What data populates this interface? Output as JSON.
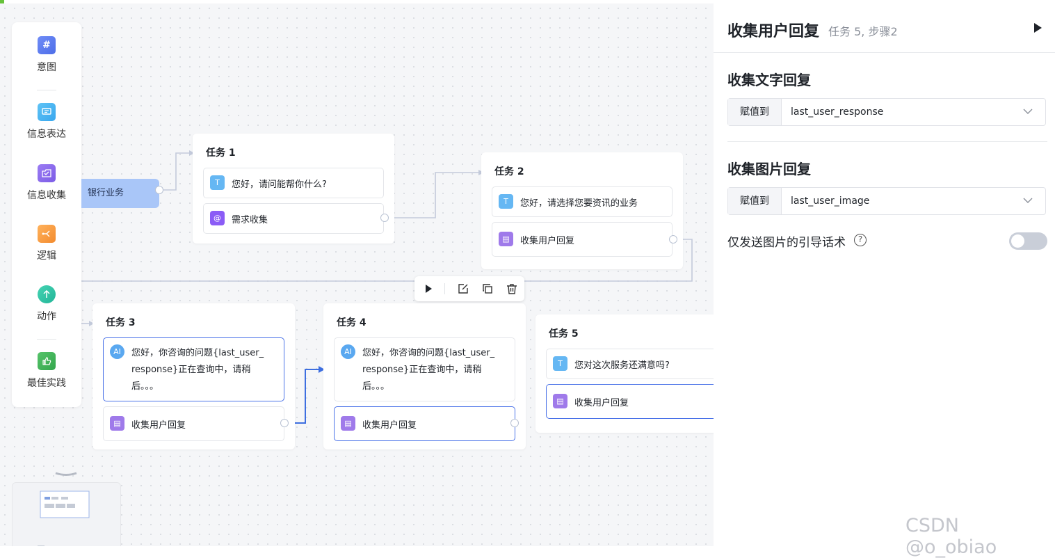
{
  "palette": {
    "items": [
      {
        "label": "意图",
        "icon": "hash-icon"
      },
      {
        "label": "信息表达",
        "icon": "message-icon"
      },
      {
        "label": "信息收集",
        "icon": "collect-icon"
      },
      {
        "label": "逻辑",
        "icon": "branch-icon"
      },
      {
        "label": "动作",
        "icon": "action-icon"
      },
      {
        "label": "最佳实践",
        "icon": "thumbs-up-icon"
      }
    ]
  },
  "canvas": {
    "entry_node": "银行业务",
    "nodes": [
      {
        "title": "任务 1",
        "steps": [
          {
            "text": "您好，请问能帮你什么?",
            "icon": "T"
          },
          {
            "text": "需求收集",
            "icon": "@"
          }
        ]
      },
      {
        "title": "任务 2",
        "steps": [
          {
            "text": "您好，请选择您要资讯的业务",
            "icon": "T"
          },
          {
            "text": "收集用户回复",
            "icon": "collect"
          }
        ]
      },
      {
        "title": "任务 3",
        "steps": [
          {
            "text": "您好，你咨询的问题{last_user_ response}正在查询中，请稍 后。。。",
            "line1": "您好，你咨询的问题{last_user_",
            "line2": "response}正在查询中，请稍",
            "line3": "后。。。",
            "icon": "AI"
          },
          {
            "text": "收集用户回复",
            "icon": "collect"
          }
        ]
      },
      {
        "title": "任务 4",
        "steps": [
          {
            "text": "您好，你咨询的问题{last_user_ response}正在查询中，请稍 后。。。",
            "line1": "您好，你咨询的问题{last_user_",
            "line2": "response}正在查询中，请稍",
            "line3": "后。。。",
            "icon": "AI"
          },
          {
            "text": "收集用户回复",
            "icon": "collect"
          }
        ]
      },
      {
        "title": "任务 5",
        "steps": [
          {
            "text": "您对这次服务还满意吗?",
            "icon": "T"
          },
          {
            "text": "收集用户回复",
            "icon": "collect"
          }
        ]
      }
    ],
    "step_icon_labels": {
      "T": "T",
      "at": "@",
      "ai": "AI",
      "collect": "▤"
    }
  },
  "toolbar": {
    "buttons": [
      "play-icon",
      "edit-icon",
      "copy-icon",
      "delete-icon"
    ]
  },
  "panel": {
    "title": "收集用户回复",
    "subtitle": "任务 5, 步骤2",
    "text_reply": {
      "section_title": "收集文字回复",
      "assign_label": "赋值到",
      "value": "last_user_response"
    },
    "image_reply": {
      "section_title": "收集图片回复",
      "assign_label": "赋值到",
      "value": "last_user_image"
    },
    "guide_only": {
      "label": "仅发送图片的引导话术",
      "help": "?",
      "enabled": false
    }
  },
  "watermark": "CSDN @o_obiao",
  "colors": {
    "accent": "#4a72e8",
    "entry_pill": "#a9c6f8",
    "toggle_off": "#c9ced8"
  }
}
